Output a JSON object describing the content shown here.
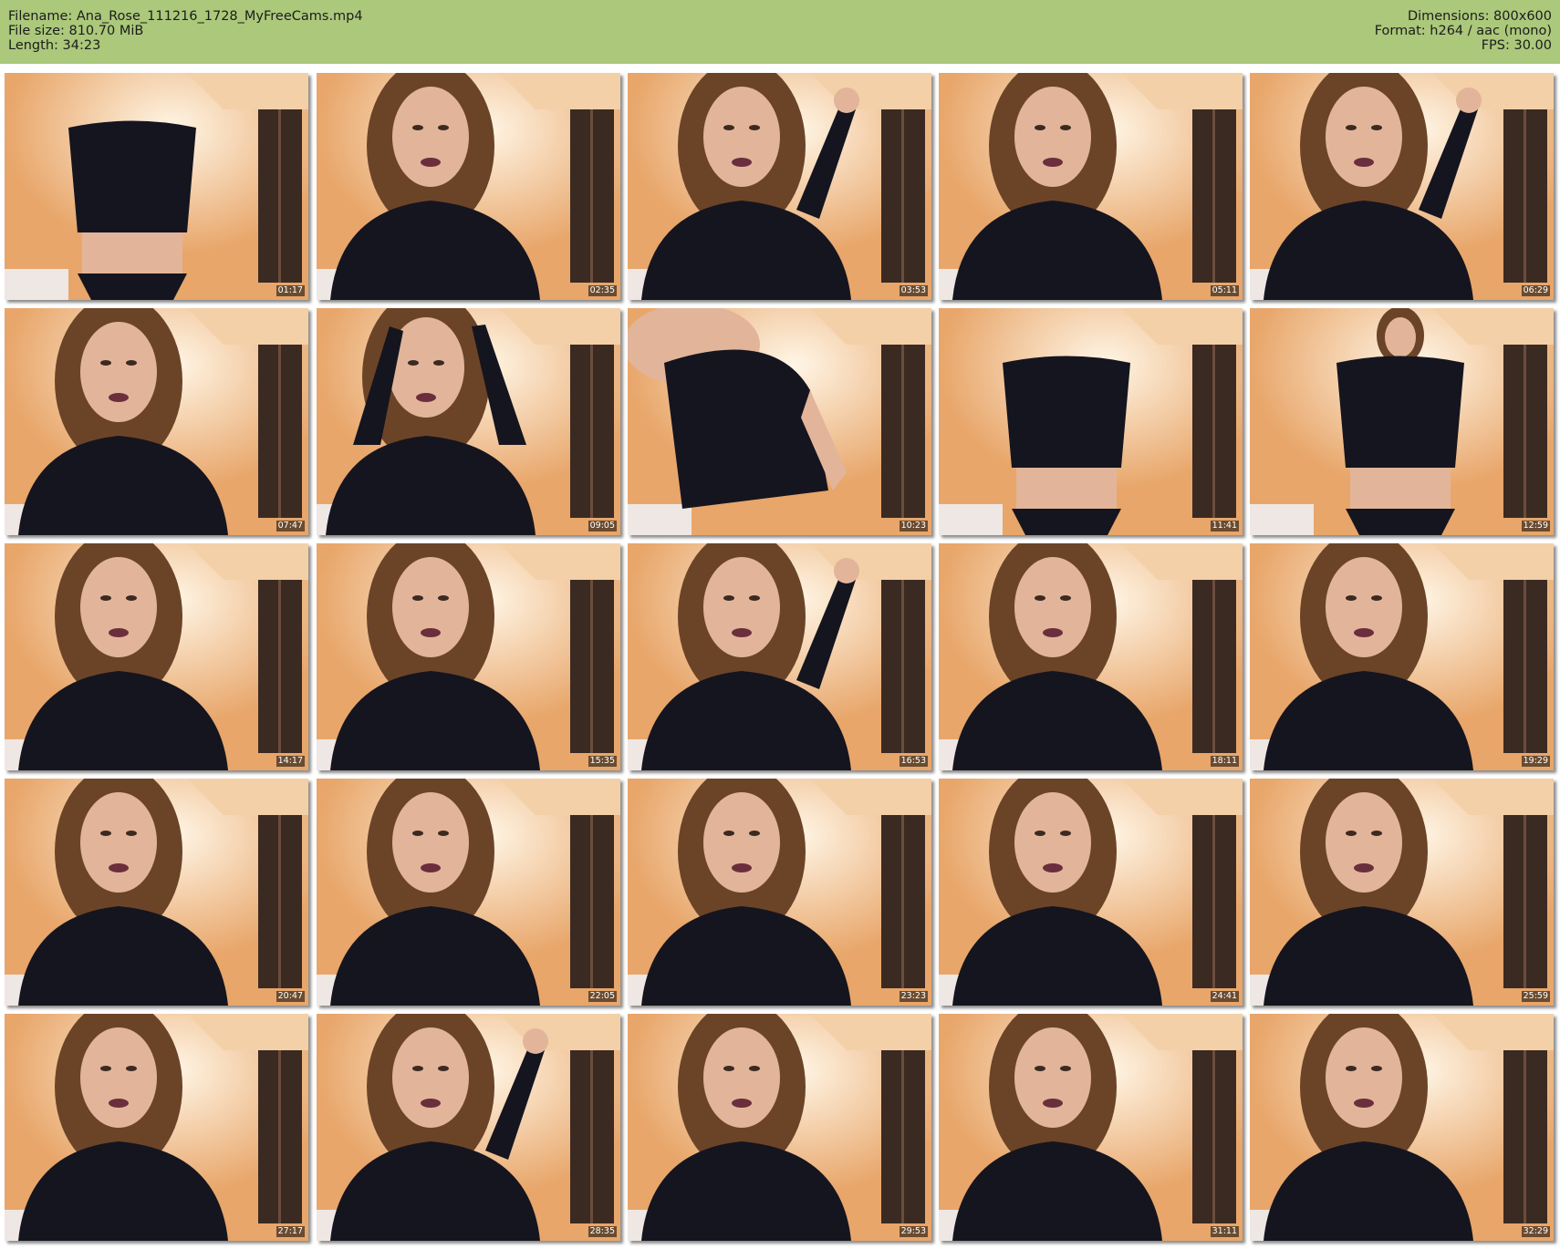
{
  "header": {
    "left": [
      "Filename: Ana_Rose_111216_1728_MyFreeCams.mp4",
      "File size: 810.70 MiB",
      "Length: 34:23"
    ],
    "right": [
      "Dimensions: 800x600",
      "Format: h264 / aac (mono)",
      "FPS: 30.00"
    ]
  },
  "colors": {
    "header_bg": "#abc87b",
    "wall": "#e8a66a",
    "light": "#fff6e6",
    "shirt": "#15151f",
    "skin": "#e2b59a",
    "hair": "#6b4428",
    "curtain": "#3a2a22"
  },
  "thumbnails": [
    {
      "timestamp": "01:17",
      "variant": "torso"
    },
    {
      "timestamp": "02:35",
      "variant": "face"
    },
    {
      "timestamp": "03:53",
      "variant": "arm-up"
    },
    {
      "timestamp": "05:11",
      "variant": "face"
    },
    {
      "timestamp": "06:29",
      "variant": "arm-up"
    },
    {
      "timestamp": "07:47",
      "variant": "face"
    },
    {
      "timestamp": "09:05",
      "variant": "arms-up"
    },
    {
      "timestamp": "10:23",
      "variant": "lean"
    },
    {
      "timestamp": "11:41",
      "variant": "torso"
    },
    {
      "timestamp": "12:59",
      "variant": "standing"
    },
    {
      "timestamp": "14:17",
      "variant": "face"
    },
    {
      "timestamp": "15:35",
      "variant": "face"
    },
    {
      "timestamp": "16:53",
      "variant": "arm-up"
    },
    {
      "timestamp": "18:11",
      "variant": "face"
    },
    {
      "timestamp": "19:29",
      "variant": "face"
    },
    {
      "timestamp": "20:47",
      "variant": "face"
    },
    {
      "timestamp": "22:05",
      "variant": "face"
    },
    {
      "timestamp": "23:23",
      "variant": "face"
    },
    {
      "timestamp": "24:41",
      "variant": "face"
    },
    {
      "timestamp": "25:59",
      "variant": "face"
    },
    {
      "timestamp": "27:17",
      "variant": "face"
    },
    {
      "timestamp": "28:35",
      "variant": "arm-up"
    },
    {
      "timestamp": "29:53",
      "variant": "face"
    },
    {
      "timestamp": "31:11",
      "variant": "face"
    },
    {
      "timestamp": "32:29",
      "variant": "face"
    }
  ]
}
